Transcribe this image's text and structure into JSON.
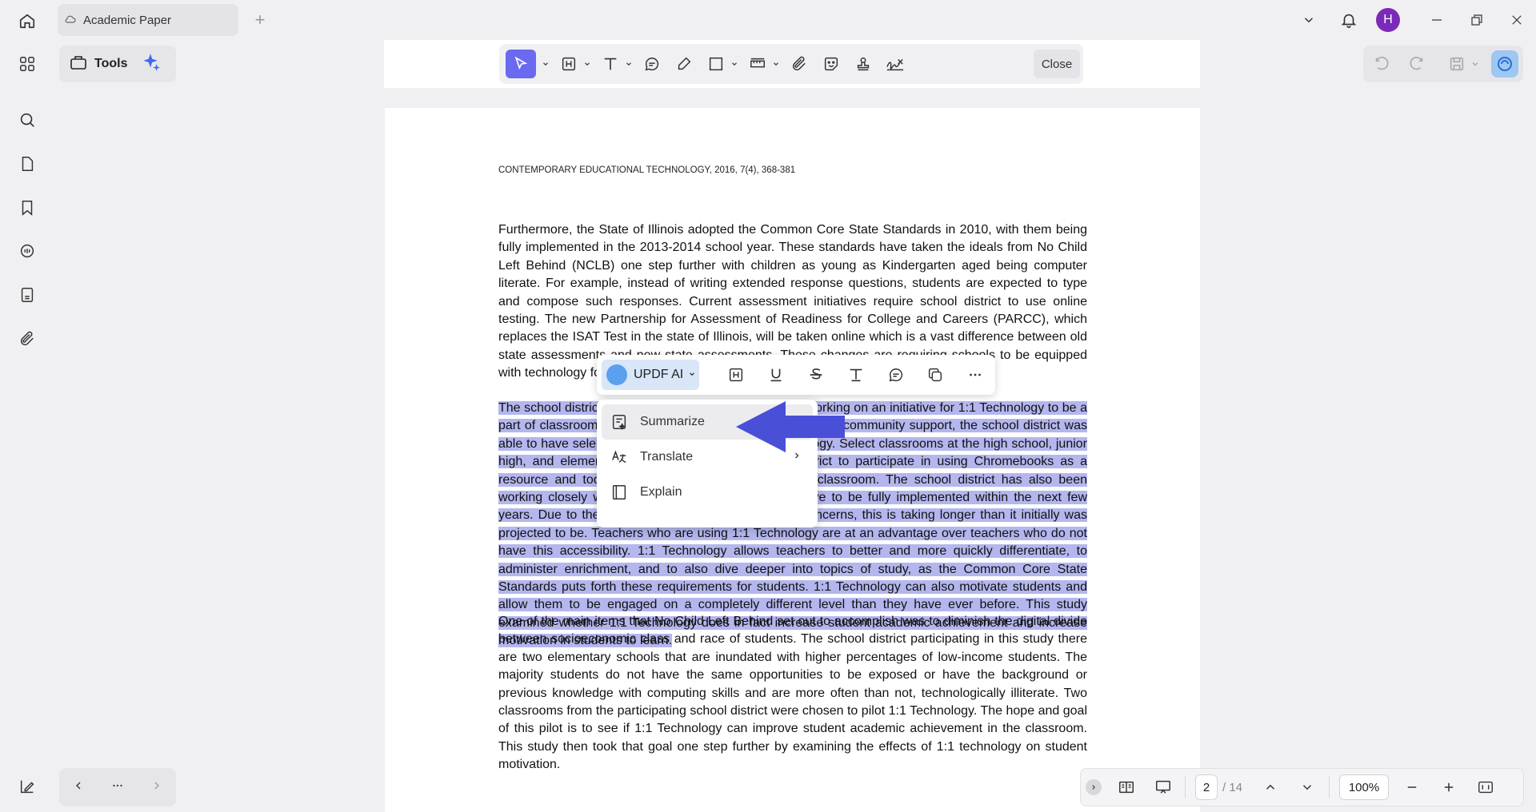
{
  "tab": {
    "title": "Academic Paper"
  },
  "tools": {
    "label": "Tools"
  },
  "toolbar": {
    "close_label": "Close"
  },
  "document": {
    "journal_header": "CONTEMPORARY EDUCATIONAL TECHNOLOGY, 2016, 7(4), 368-381",
    "paragraph1": "Furthermore, the State of Illinois adopted the Common Core State Standards in 2010, with them being fully implemented in the 2013-2014 school year. These standards have taken the ideals from No Child Left Behind (NCLB) one step further with children as young as Kindergarten aged being computer literate. For example, instead of writing extended response questions, students are expected to type and compose such responses. Current assessment initiatives require school district to use online testing. The new Partnership for Assessment of Readiness for College and Careers (PARCC), which replaces the ISAT Test in the state of Illinois, will be taken online which is a vast difference between old state assessments and new state assessments. These changes are requiring schools to be equipped with technology for students and faculty.",
    "paragraph2": "The school district participating in this study has been working on an initiative for 1:1 Technology to be a part of classrooms in the district. Through grant money and community support, the school district was able to have select classrooms piloted with 1:1 Technology. Select classrooms at the high school, junior high, and elementary levels were chosen by the district to participate in using Chromebooks as a resource and tool for instruction and learning in the classroom. The school district has also been working closely with local business for this 1:1 initiative to be fully implemented within the next few years. Due to the State of Illinois’ continued budget concerns, this is taking longer than it initially was projected to be. Teachers who are using 1:1 Technology are at an advantage over teachers who do not have this accessibility. 1:1 Technology allows teachers to better and more quickly differentiate, to administer enrichment, and to also dive deeper into topics of study, as the Common Core State Standards puts forth these requirements for students. 1:1 Technology can also motivate students and allow them to be engaged on a completely different level than they have ever before. This study examined whether 1:1 Technology does in fact increase student academic achievement and increase motivation in students to learn.",
    "paragraph3": "One of the main items that No Child Left Behind set out to accomplish was to diminish the digital divide between socioeconomic class and race of students. The school district participating in this study there are two elementary schools that are inundated with higher percentages of low-income students. The majority students do not have the same opportunities to be exposed or have the background or previous knowledge with computing skills and are more often than not, technologically illiterate. Two classrooms from the participating school district were chosen to pilot 1:1 Technology. The hope and goal of this pilot is to see if 1:1 Technology can improve student academic achievement in the classroom. This study then took that goal one step further by examining the effects of 1:1 technology on student motivation."
  },
  "selection_toolbar": {
    "ai_label": "UPDF AI"
  },
  "ai_menu": {
    "items": [
      {
        "label": "Summarize"
      },
      {
        "label": "Translate"
      },
      {
        "label": "Explain"
      }
    ]
  },
  "page_nav": {
    "current": "2",
    "total": "/ 14",
    "zoom": "100%"
  },
  "user": {
    "initial": "H"
  },
  "colors": {
    "accent": "#6a6af0",
    "highlight": "#b4b6ee",
    "arrow": "#4a4fd8",
    "avatar": "#7a2ab8"
  }
}
